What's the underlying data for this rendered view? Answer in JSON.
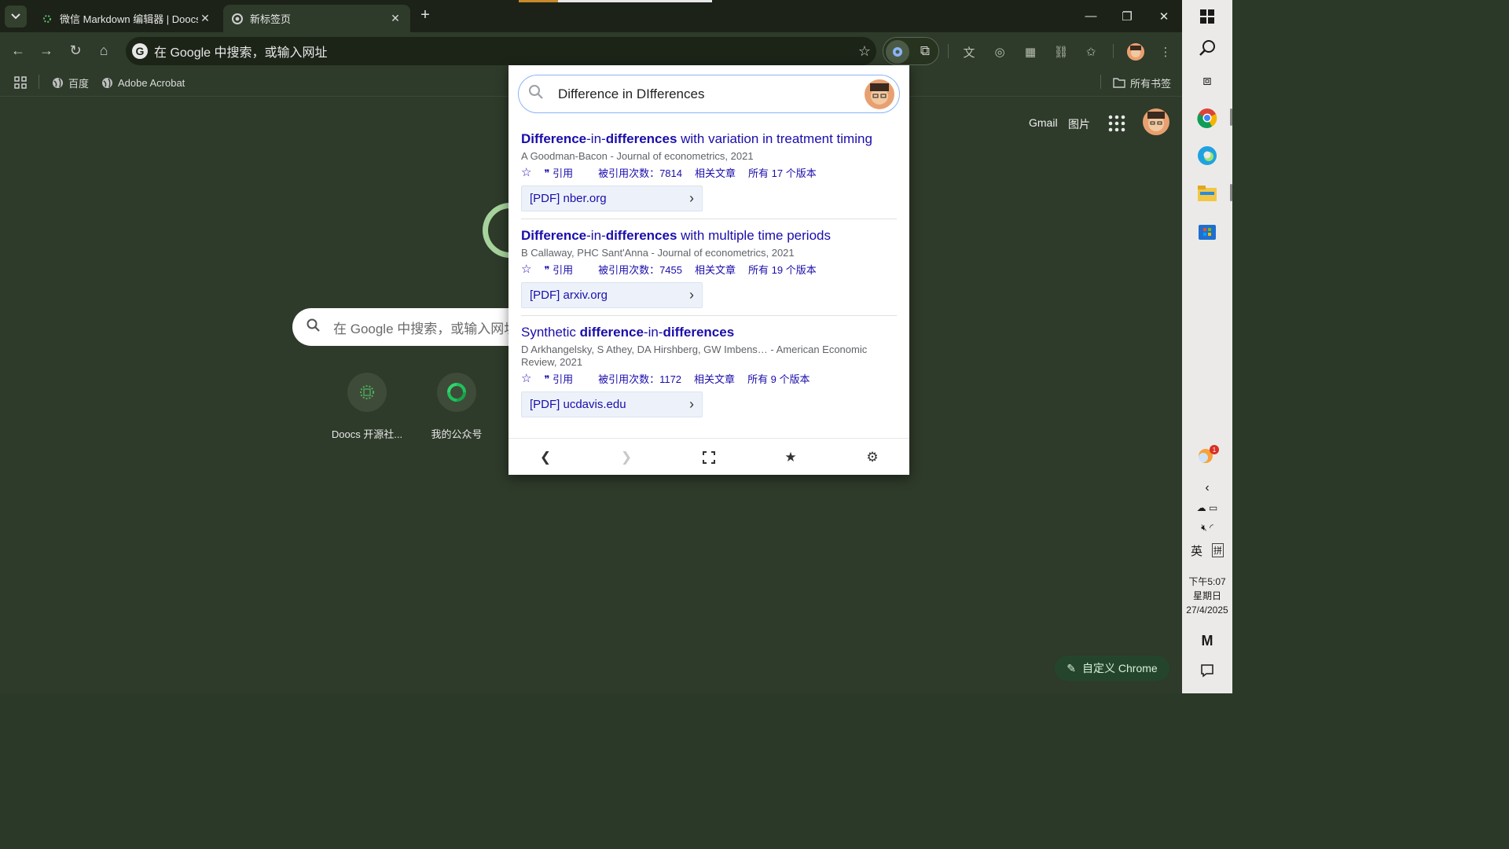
{
  "tabs": {
    "inactive": {
      "title": "微信 Markdown 编辑器 | Doocs"
    },
    "active": {
      "title": "新标签页"
    }
  },
  "omnibox": {
    "text": "在 Google 中搜索，或输入网址"
  },
  "bookmarks": {
    "items": [
      {
        "label": "百度"
      },
      {
        "label": "Adobe Acrobat"
      }
    ],
    "all_bookmarks": "所有书签"
  },
  "ntp": {
    "gmail": "Gmail",
    "images": "图片",
    "search_placeholder": "在 Google 中搜索，或输入网址",
    "shortcuts": [
      {
        "label": "Doocs 开源社..."
      },
      {
        "label": "我的公众号"
      }
    ],
    "customize": "自定义 Chrome"
  },
  "popup": {
    "query": "Difference in DIfferences",
    "results": [
      {
        "title_parts": {
          "a": "Difference",
          "b": "-in-",
          "c": "differences",
          "d": " with variation in treatment timing"
        },
        "authors": "A Goodman-Bacon - Journal of econometrics, 2021",
        "cite": "引用",
        "cited_by": "被引用次数：7814",
        "related": "相关文章",
        "versions": "所有 17 个版本",
        "pdf": "[PDF] nber.org"
      },
      {
        "title_parts": {
          "a": "Difference",
          "b": "-in-",
          "c": "differences",
          "d": " with multiple time periods"
        },
        "authors": "B Callaway, PHC Sant'Anna - Journal of econometrics, 2021",
        "cite": "引用",
        "cited_by": "被引用次数：7455",
        "related": "相关文章",
        "versions": "所有 19 个版本",
        "pdf": "[PDF] arxiv.org"
      },
      {
        "title_parts": {
          "a": "Synthetic ",
          "b": "difference",
          "c": "-in-",
          "d": "differences"
        },
        "authors": "D Arkhangelsky, S Athey, DA Hirshberg, GW Imbens… - American Economic Review, 2021",
        "cite": "引用",
        "cited_by": "被引用次数：1172",
        "related": "相关文章",
        "versions": "所有 9 个版本",
        "pdf": "[PDF] ucdavis.edu"
      }
    ]
  },
  "taskbar": {
    "ime_lang": "英",
    "ime_mode": "拼",
    "time": "下午5:07",
    "weekday": "星期日",
    "date": "27/4/2025",
    "notification_count": "1"
  },
  "colors": {
    "accent_link": "#1a0dab",
    "ntp_bg": "#2e3a2a",
    "tabstrip_bg": "#1c2218"
  }
}
